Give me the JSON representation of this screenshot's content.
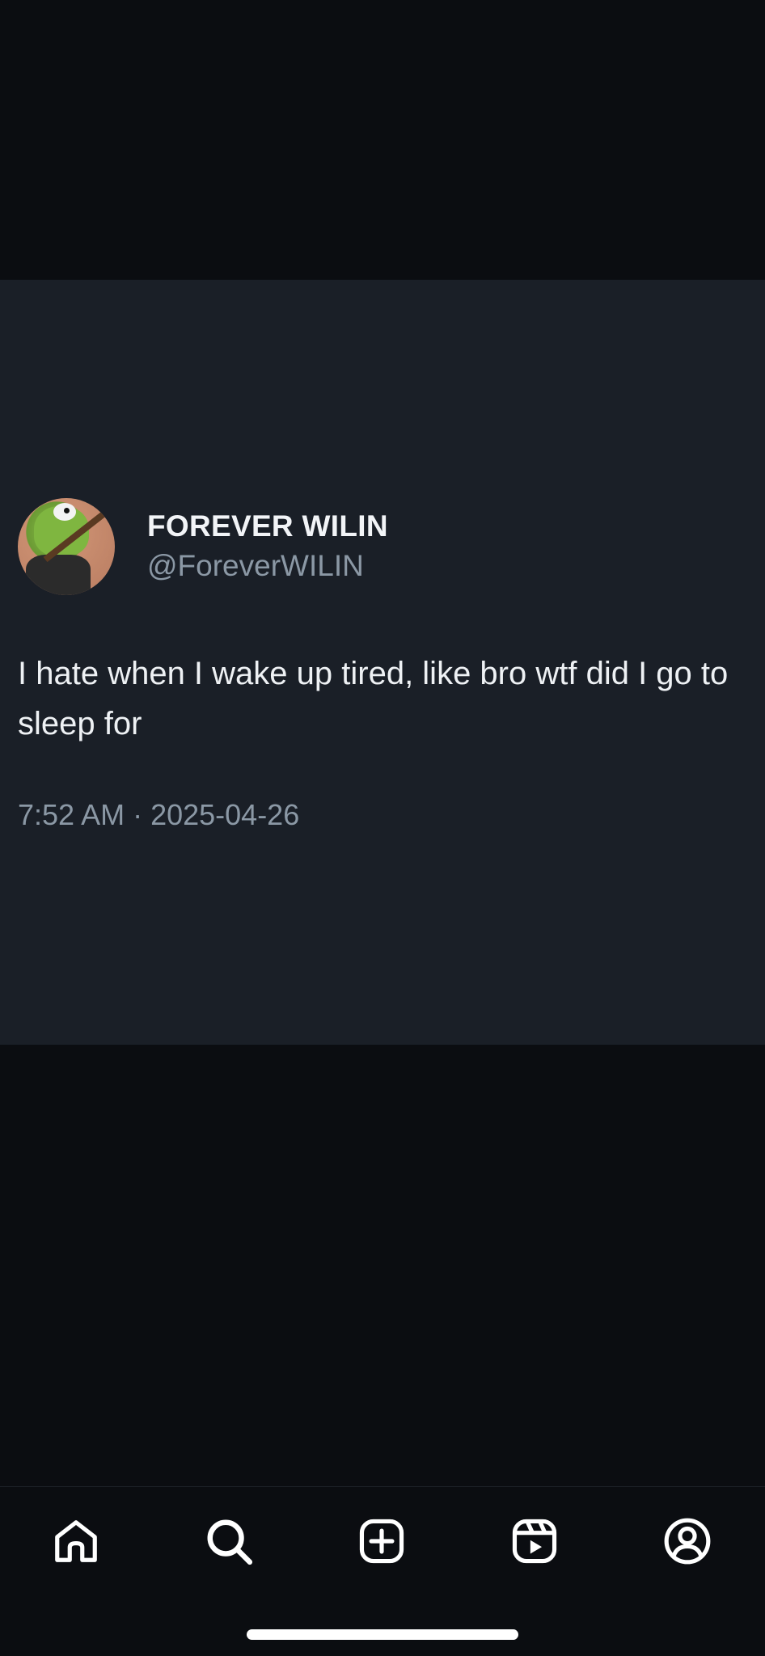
{
  "post": {
    "author": {
      "display_name": "FOREVER WILIN",
      "handle": "@ForeverWILIN",
      "avatar_icon": "frog-avatar-icon"
    },
    "text": "I hate when I wake up tired, like bro wtf did I go to sleep for",
    "timestamp": "7:52 AM · 2025-04-26"
  },
  "nav": {
    "items": [
      {
        "name": "home",
        "icon": "home-icon"
      },
      {
        "name": "search",
        "icon": "search-icon"
      },
      {
        "name": "create",
        "icon": "plus-square-icon"
      },
      {
        "name": "reels",
        "icon": "reels-icon"
      },
      {
        "name": "profile",
        "icon": "profile-icon"
      }
    ]
  },
  "colors": {
    "background": "#0b0d11",
    "card": "#1a1f27",
    "text_primary": "#f2f4f7",
    "text_secondary": "#8b98a5"
  }
}
